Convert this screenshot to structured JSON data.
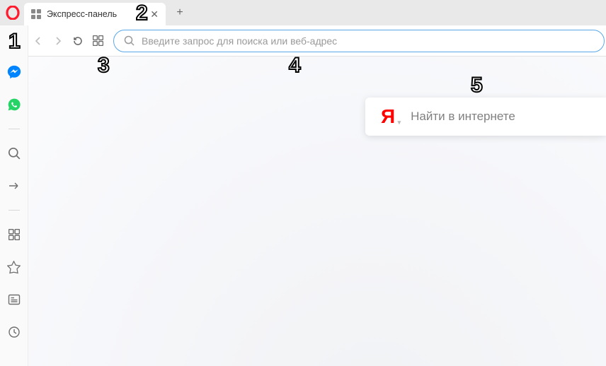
{
  "tabs": {
    "active_title": "Экспресс-панель"
  },
  "toolbar": {
    "address_placeholder": "Введите запрос для поиска или веб-адрес"
  },
  "speeddial": {
    "search_provider_glyph": "Я",
    "search_placeholder": "Найти в интернете"
  },
  "callouts": {
    "n1": "1",
    "n2": "2",
    "n3": "3",
    "n4": "4",
    "n5": "5"
  }
}
